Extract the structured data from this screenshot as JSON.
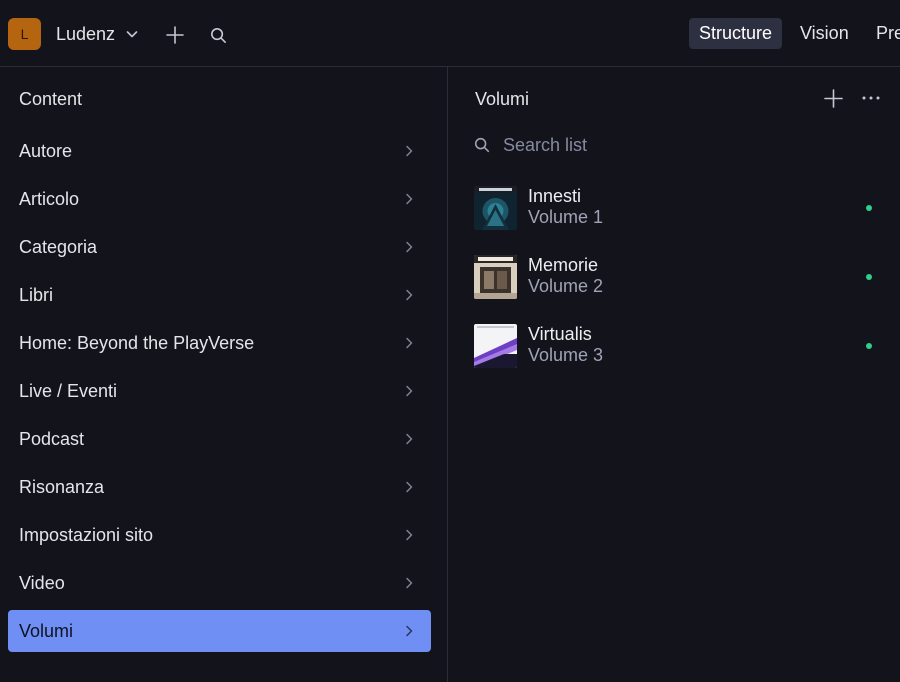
{
  "topbar": {
    "workspace_initial": "L",
    "workspace_name": "Ludenz",
    "tools": [
      {
        "label": "Structure",
        "active": true
      },
      {
        "label": "Vision",
        "active": false
      },
      {
        "label": "Pre",
        "active": false
      }
    ]
  },
  "content_pane": {
    "title": "Content",
    "items": [
      {
        "label": "Autore"
      },
      {
        "label": "Articolo"
      },
      {
        "label": "Categoria"
      },
      {
        "label": "Libri"
      },
      {
        "label": "Home: Beyond the PlayVerse"
      },
      {
        "label": "Live / Eventi"
      },
      {
        "label": "Podcast"
      },
      {
        "label": "Risonanza"
      },
      {
        "label": "Impostazioni sito"
      },
      {
        "label": "Video"
      },
      {
        "label": "Volumi",
        "active": true
      }
    ]
  },
  "list_pane": {
    "title": "Volumi",
    "search_placeholder": "Search list",
    "documents": [
      {
        "title": "Innesti",
        "subtitle": "Volume 1",
        "status": "published"
      },
      {
        "title": "Memorie",
        "subtitle": "Volume 2",
        "status": "published"
      },
      {
        "title": "Virtualis",
        "subtitle": "Volume 3",
        "status": "published"
      }
    ]
  },
  "colors": {
    "background": "#13141b",
    "accent": "#6f8ff5",
    "workspace_avatar": "#b5650f",
    "status_published": "#2fce8a",
    "active_tool_bg": "#2d3040"
  },
  "icons": {
    "workspace_menu": "chevron-down-icon",
    "create": "plus-icon",
    "search": "search-icon",
    "menu_item": "chevron-right-icon",
    "more": "ellipsis-icon"
  }
}
